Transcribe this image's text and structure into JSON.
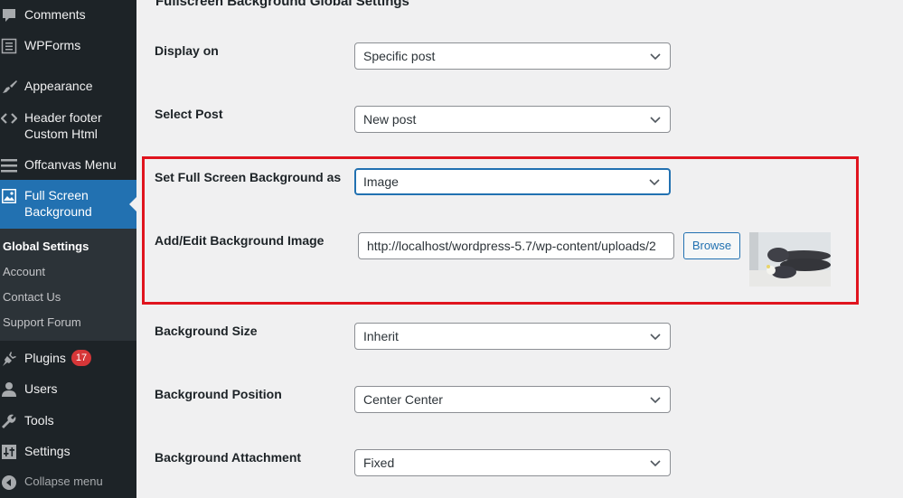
{
  "sidebar": {
    "items": [
      {
        "label": "Comments",
        "icon": "comment-icon"
      },
      {
        "label": "WPForms",
        "icon": "wpforms-icon"
      },
      {
        "label": "Appearance",
        "icon": "paintbrush-icon"
      },
      {
        "label": "Header footer Custom Html",
        "line1": "Header footer",
        "line2": "Custom Html",
        "icon": "code-icon"
      },
      {
        "label": "Offcanvas Menu",
        "icon": "menu-icon"
      },
      {
        "label": "Full Screen Background",
        "line1": "Full Screen",
        "line2": "Background",
        "icon": "image-icon",
        "current": true
      },
      {
        "label": "Plugins",
        "icon": "plugin-icon",
        "badge": "17"
      },
      {
        "label": "Users",
        "icon": "user-icon"
      },
      {
        "label": "Tools",
        "icon": "wrench-icon"
      },
      {
        "label": "Settings",
        "icon": "settings-icon"
      },
      {
        "label": "Collapse menu",
        "icon": "collapse-icon"
      }
    ],
    "submenu": [
      {
        "label": "Global Settings",
        "active": true
      },
      {
        "label": "Account"
      },
      {
        "label": "Contact Us"
      },
      {
        "label": "Support Forum"
      }
    ]
  },
  "main": {
    "title": "Fullscreen Background Global Settings",
    "fields": {
      "display_on": {
        "label": "Display on",
        "value": "Specific post"
      },
      "select_post": {
        "label": "Select Post",
        "value": "New post"
      },
      "set_as": {
        "label": "Set Full Screen Background as",
        "value": "Image"
      },
      "bg_image": {
        "label": "Add/Edit Background Image",
        "value": "http://localhost/wordpress-5.7/wp-content/uploads/2",
        "button": "Browse"
      },
      "bg_size": {
        "label": "Background Size",
        "value": "Inherit"
      },
      "bg_position": {
        "label": "Background Position",
        "value": "Center Center"
      },
      "bg_attachment": {
        "label": "Background Attachment",
        "value": "Fixed"
      }
    }
  },
  "colors": {
    "sidebar_bg": "#1d2327",
    "submenu_bg": "#2c3338",
    "accent": "#2271b1",
    "badge": "#d63638",
    "highlight": "#e0141e"
  }
}
